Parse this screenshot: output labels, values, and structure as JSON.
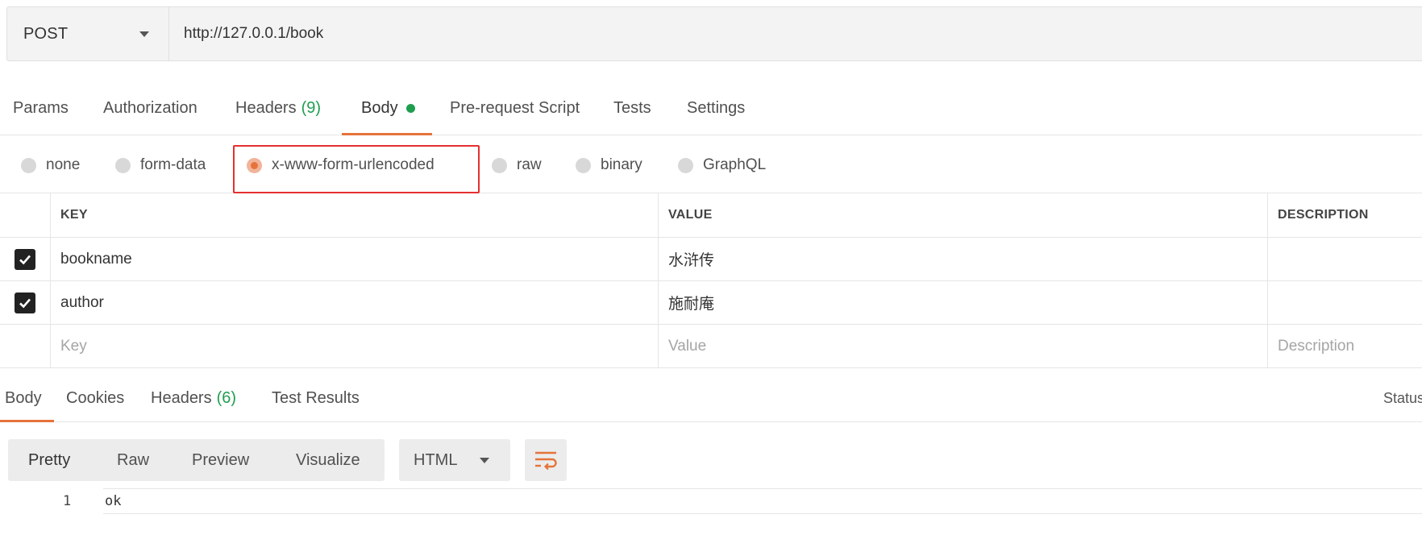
{
  "request": {
    "method": "POST",
    "url": "http://127.0.0.1/book"
  },
  "request_tabs": [
    {
      "label": "Params",
      "count": ""
    },
    {
      "label": "Authorization",
      "count": ""
    },
    {
      "label": "Headers",
      "count": "(9)"
    },
    {
      "label": "Body",
      "count": ""
    },
    {
      "label": "Pre-request Script",
      "count": ""
    },
    {
      "label": "Tests",
      "count": ""
    },
    {
      "label": "Settings",
      "count": ""
    }
  ],
  "active_request_tab": "Body",
  "body_types": [
    {
      "label": "none",
      "checked": false
    },
    {
      "label": "form-data",
      "checked": false
    },
    {
      "label": "x-www-form-urlencoded",
      "checked": true
    },
    {
      "label": "raw",
      "checked": false
    },
    {
      "label": "binary",
      "checked": false
    },
    {
      "label": "GraphQL",
      "checked": false
    }
  ],
  "table": {
    "headers": {
      "key": "KEY",
      "value": "VALUE",
      "description": "DESCRIPTION"
    },
    "rows": [
      {
        "key": "bookname",
        "value": "水浒传",
        "description": "",
        "checked": true
      },
      {
        "key": "author",
        "value": "施耐庵",
        "description": "",
        "checked": true
      }
    ],
    "placeholders": {
      "key": "Key",
      "value": "Value",
      "description": "Description"
    }
  },
  "response_tabs": [
    {
      "label": "Body",
      "count": ""
    },
    {
      "label": "Cookies",
      "count": ""
    },
    {
      "label": "Headers",
      "count": "(6)"
    },
    {
      "label": "Test Results",
      "count": ""
    }
  ],
  "response_status_label": "Status",
  "view_modes": [
    "Pretty",
    "Raw",
    "Preview",
    "Visualize"
  ],
  "active_view_mode": "Pretty",
  "format": "HTML",
  "response_body": {
    "line_number": "1",
    "content": "ok"
  },
  "colors": {
    "accent": "#e5733b",
    "success": "#1f9e4f",
    "highlight_box": "#e53030"
  },
  "icons": {
    "method_dropdown": "chevron-down-icon",
    "format_dropdown": "chevron-down-icon",
    "wrap": "wrap-lines-icon",
    "check": "checkmark-icon"
  }
}
